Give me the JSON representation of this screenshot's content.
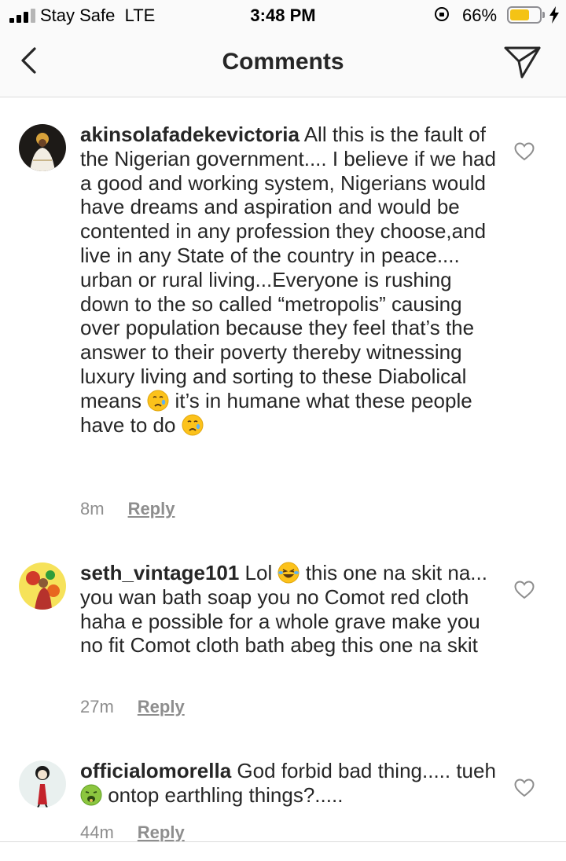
{
  "status_bar": {
    "carrier": "Stay Safe  LTE",
    "time": "3:48 PM",
    "battery_percent": "66%",
    "battery_level": 0.66,
    "battery_color": "#f4c315"
  },
  "header": {
    "back_icon": "chevron-left-icon",
    "title": "Comments",
    "send_icon": "paper-plane-icon"
  },
  "comments": [
    {
      "username": "akinsolafadekevictoria",
      "text_before_emoji": " All this is the fault of the Nigerian government.... I believe if we had a good and working system, Nigerians  would have dreams and aspiration and would be contented in any profession they choose,and live in any State of the country in peace.... urban or rural living...Everyone is rushing down to the so called “metropolis” causing over population because they feel that’s the answer to their poverty thereby witnessing luxury living and sorting to these Diabolical means ",
      "emoji_1": "crying-face-emoji",
      "text_middle": "  it’s in humane what these people have to do ",
      "emoji_2": "crying-face-emoji",
      "time": "8m",
      "reply_label": "Reply"
    },
    {
      "username": "seth_vintage101",
      "text_before_emoji": " Lol ",
      "emoji_1": "face-with-tears-of-joy-emoji",
      "text_middle": "  this one na skit na... you wan bath soap you no Comot red cloth haha e possible for a whole grave make you no fit Comot cloth bath abeg this one na skit",
      "time": "27m",
      "reply_label": "Reply"
    },
    {
      "username": "officialomorella",
      "text_before_emoji": " God forbid bad thing..... tueh ",
      "emoji_1": "nauseated-face-emoji",
      "text_middle": "  ontop earthling things?.....",
      "time": "44m",
      "reply_label": "Reply"
    }
  ],
  "icons": {
    "like": "heart-outline-icon"
  }
}
